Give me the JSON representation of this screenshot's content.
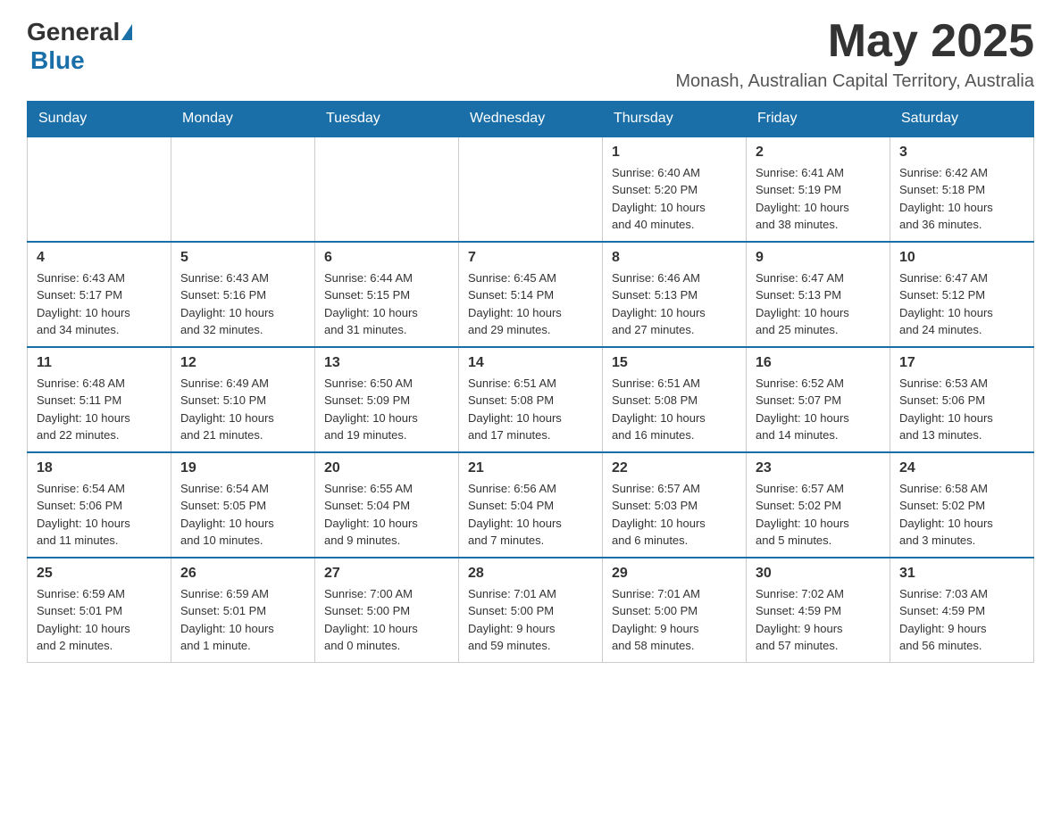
{
  "logo": {
    "general": "General",
    "blue": "Blue"
  },
  "header": {
    "month_title": "May 2025",
    "location": "Monash, Australian Capital Territory, Australia"
  },
  "weekdays": [
    "Sunday",
    "Monday",
    "Tuesday",
    "Wednesday",
    "Thursday",
    "Friday",
    "Saturday"
  ],
  "weeks": [
    [
      {
        "day": "",
        "info": ""
      },
      {
        "day": "",
        "info": ""
      },
      {
        "day": "",
        "info": ""
      },
      {
        "day": "",
        "info": ""
      },
      {
        "day": "1",
        "info": "Sunrise: 6:40 AM\nSunset: 5:20 PM\nDaylight: 10 hours\nand 40 minutes."
      },
      {
        "day": "2",
        "info": "Sunrise: 6:41 AM\nSunset: 5:19 PM\nDaylight: 10 hours\nand 38 minutes."
      },
      {
        "day": "3",
        "info": "Sunrise: 6:42 AM\nSunset: 5:18 PM\nDaylight: 10 hours\nand 36 minutes."
      }
    ],
    [
      {
        "day": "4",
        "info": "Sunrise: 6:43 AM\nSunset: 5:17 PM\nDaylight: 10 hours\nand 34 minutes."
      },
      {
        "day": "5",
        "info": "Sunrise: 6:43 AM\nSunset: 5:16 PM\nDaylight: 10 hours\nand 32 minutes."
      },
      {
        "day": "6",
        "info": "Sunrise: 6:44 AM\nSunset: 5:15 PM\nDaylight: 10 hours\nand 31 minutes."
      },
      {
        "day": "7",
        "info": "Sunrise: 6:45 AM\nSunset: 5:14 PM\nDaylight: 10 hours\nand 29 minutes."
      },
      {
        "day": "8",
        "info": "Sunrise: 6:46 AM\nSunset: 5:13 PM\nDaylight: 10 hours\nand 27 minutes."
      },
      {
        "day": "9",
        "info": "Sunrise: 6:47 AM\nSunset: 5:13 PM\nDaylight: 10 hours\nand 25 minutes."
      },
      {
        "day": "10",
        "info": "Sunrise: 6:47 AM\nSunset: 5:12 PM\nDaylight: 10 hours\nand 24 minutes."
      }
    ],
    [
      {
        "day": "11",
        "info": "Sunrise: 6:48 AM\nSunset: 5:11 PM\nDaylight: 10 hours\nand 22 minutes."
      },
      {
        "day": "12",
        "info": "Sunrise: 6:49 AM\nSunset: 5:10 PM\nDaylight: 10 hours\nand 21 minutes."
      },
      {
        "day": "13",
        "info": "Sunrise: 6:50 AM\nSunset: 5:09 PM\nDaylight: 10 hours\nand 19 minutes."
      },
      {
        "day": "14",
        "info": "Sunrise: 6:51 AM\nSunset: 5:08 PM\nDaylight: 10 hours\nand 17 minutes."
      },
      {
        "day": "15",
        "info": "Sunrise: 6:51 AM\nSunset: 5:08 PM\nDaylight: 10 hours\nand 16 minutes."
      },
      {
        "day": "16",
        "info": "Sunrise: 6:52 AM\nSunset: 5:07 PM\nDaylight: 10 hours\nand 14 minutes."
      },
      {
        "day": "17",
        "info": "Sunrise: 6:53 AM\nSunset: 5:06 PM\nDaylight: 10 hours\nand 13 minutes."
      }
    ],
    [
      {
        "day": "18",
        "info": "Sunrise: 6:54 AM\nSunset: 5:06 PM\nDaylight: 10 hours\nand 11 minutes."
      },
      {
        "day": "19",
        "info": "Sunrise: 6:54 AM\nSunset: 5:05 PM\nDaylight: 10 hours\nand 10 minutes."
      },
      {
        "day": "20",
        "info": "Sunrise: 6:55 AM\nSunset: 5:04 PM\nDaylight: 10 hours\nand 9 minutes."
      },
      {
        "day": "21",
        "info": "Sunrise: 6:56 AM\nSunset: 5:04 PM\nDaylight: 10 hours\nand 7 minutes."
      },
      {
        "day": "22",
        "info": "Sunrise: 6:57 AM\nSunset: 5:03 PM\nDaylight: 10 hours\nand 6 minutes."
      },
      {
        "day": "23",
        "info": "Sunrise: 6:57 AM\nSunset: 5:02 PM\nDaylight: 10 hours\nand 5 minutes."
      },
      {
        "day": "24",
        "info": "Sunrise: 6:58 AM\nSunset: 5:02 PM\nDaylight: 10 hours\nand 3 minutes."
      }
    ],
    [
      {
        "day": "25",
        "info": "Sunrise: 6:59 AM\nSunset: 5:01 PM\nDaylight: 10 hours\nand 2 minutes."
      },
      {
        "day": "26",
        "info": "Sunrise: 6:59 AM\nSunset: 5:01 PM\nDaylight: 10 hours\nand 1 minute."
      },
      {
        "day": "27",
        "info": "Sunrise: 7:00 AM\nSunset: 5:00 PM\nDaylight: 10 hours\nand 0 minutes."
      },
      {
        "day": "28",
        "info": "Sunrise: 7:01 AM\nSunset: 5:00 PM\nDaylight: 9 hours\nand 59 minutes."
      },
      {
        "day": "29",
        "info": "Sunrise: 7:01 AM\nSunset: 5:00 PM\nDaylight: 9 hours\nand 58 minutes."
      },
      {
        "day": "30",
        "info": "Sunrise: 7:02 AM\nSunset: 4:59 PM\nDaylight: 9 hours\nand 57 minutes."
      },
      {
        "day": "31",
        "info": "Sunrise: 7:03 AM\nSunset: 4:59 PM\nDaylight: 9 hours\nand 56 minutes."
      }
    ]
  ],
  "colors": {
    "header_bg": "#1a6fa8",
    "header_text": "#ffffff",
    "border": "#1a6fa8",
    "cell_border": "#cccccc"
  }
}
